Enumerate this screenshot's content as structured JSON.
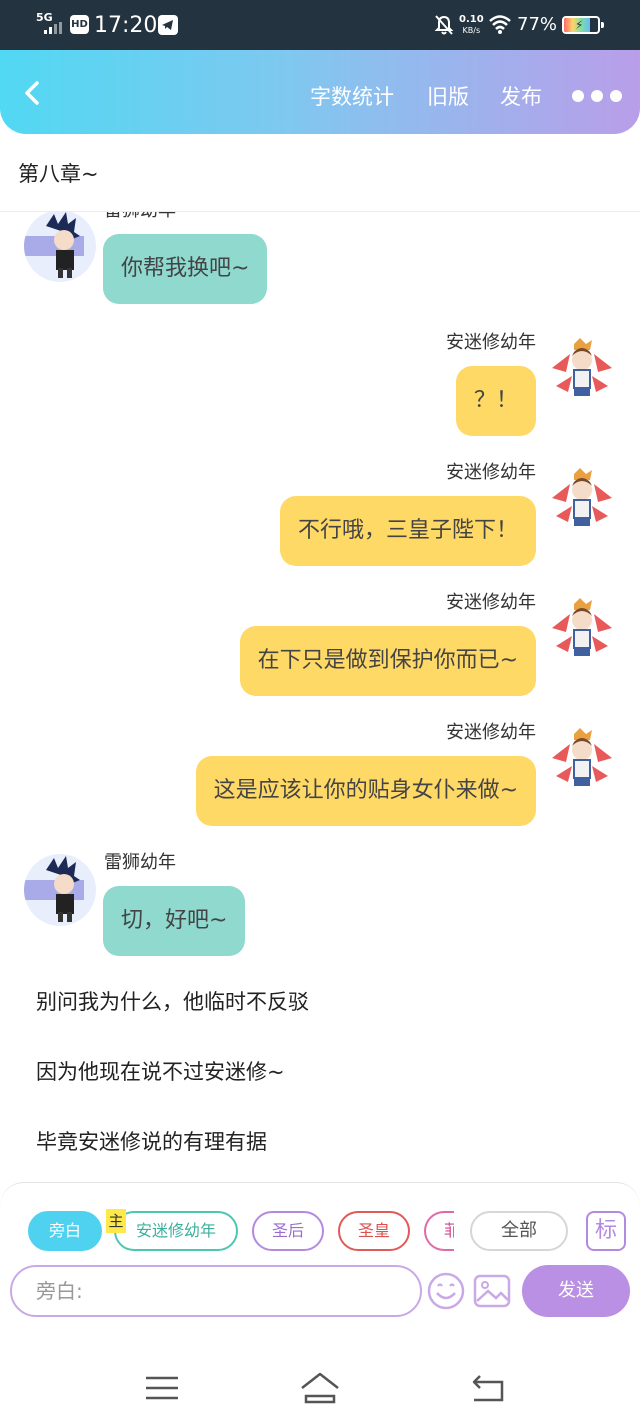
{
  "status_bar": {
    "network": "5G",
    "hd": "HD",
    "time": "17:20",
    "speed_value": "0.10",
    "speed_unit": "KB/s",
    "battery_percent": "77%",
    "battery_level": 0.77,
    "icons": [
      "signal-icon",
      "hd-icon",
      "telegram-icon",
      "mute-icon",
      "wifi-icon",
      "battery-icon"
    ]
  },
  "header": {
    "back_icon": "chevron-left-icon",
    "word_count": "字数统计",
    "old_version": "旧版",
    "publish": "发布",
    "more_icon": "more-dots-icon",
    "gradient": [
      "#51d8f2",
      "#b99ee9"
    ]
  },
  "chapter": {
    "title": "第八章~"
  },
  "chat": {
    "messages": [
      {
        "side": "left",
        "name": "雷狮幼年",
        "text": "你帮我换吧~"
      },
      {
        "side": "right",
        "name": "安迷修幼年",
        "text": "？！"
      },
      {
        "side": "right",
        "name": "安迷修幼年",
        "text": "不行哦，三皇子陛下！"
      },
      {
        "side": "right",
        "name": "安迷修幼年",
        "text": "在下只是做到保护你而已~"
      },
      {
        "side": "right",
        "name": "安迷修幼年",
        "text": "这是应该让你的贴身女仆来做~"
      },
      {
        "side": "left",
        "name": "雷狮幼年",
        "text": "切，好吧~"
      }
    ],
    "narration": [
      "别问我为什么，他临时不反驳",
      "因为他现在说不过安迷修~",
      "毕竟安迷修说的有理有据"
    ],
    "colors": {
      "left_bubble": "#8fd9cf",
      "right_bubble": "#ffd966"
    }
  },
  "composer": {
    "roles": {
      "narrator": "旁白",
      "main_tag": "主",
      "anmixiu": "安迷修幼年",
      "empress": "圣后",
      "emperor": "圣皇",
      "partial": "菲",
      "all": "全部"
    },
    "mark_button": "标",
    "input_placeholder": "旁白:",
    "send": "发送",
    "emoji_icon": "emoji-icon",
    "image_icon": "image-icon",
    "accent": "#b990e4"
  },
  "navbar": {
    "icons": [
      "menu-icon",
      "home-icon",
      "back-icon"
    ]
  }
}
